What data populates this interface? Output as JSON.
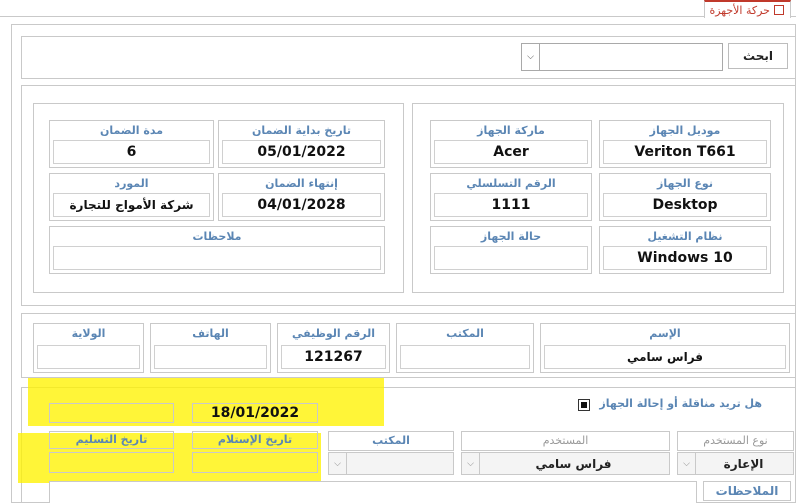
{
  "tab": {
    "title": "حركة الأجهزة"
  },
  "search": {
    "button_label": "ابحث",
    "value": ""
  },
  "device": {
    "model": {
      "label": "موديل الجهاز",
      "value": "Veriton T661"
    },
    "brand": {
      "label": "ماركة الجهاز",
      "value": "Acer"
    },
    "type": {
      "label": "نوع الجهاز",
      "value": "Desktop"
    },
    "serial": {
      "label": "الرقم التسلسلي",
      "value": "1111"
    },
    "os": {
      "label": "نظام التشغيل",
      "value": "Windows 10"
    },
    "status": {
      "label": "حالة الجهاز",
      "value": ""
    }
  },
  "warranty": {
    "start": {
      "label": "تاريخ بداية الضمان",
      "value": "05/01/2022"
    },
    "duration": {
      "label": "مدة الضمان",
      "value": "6"
    },
    "end": {
      "label": "إنتهاء الضمان",
      "value": "04/01/2028"
    },
    "supplier": {
      "label": "المورد",
      "value": "شركة الأمواج للتجارة"
    },
    "notes": {
      "label": "ملاحظات",
      "value": ""
    }
  },
  "employee": {
    "name": {
      "label": "الإسم",
      "value": "فراس سامي"
    },
    "office": {
      "label": "المكتب",
      "value": ""
    },
    "job_number": {
      "label": "الرقم الوظيفي",
      "value": "121267"
    },
    "phone": {
      "label": "الهاتف",
      "value": ""
    },
    "province": {
      "label": "الولاية",
      "value": ""
    }
  },
  "transfer": {
    "question": "هل تريد مناقلة أو إحالة الجهاز",
    "checked": true,
    "date_value": "18/01/2022",
    "user_type": {
      "label": "نوع المستخدم",
      "value": "الإعارة"
    },
    "user": {
      "label": "المستخدم",
      "value": "فراس سامي"
    },
    "office": {
      "label": "المكتب",
      "value": ""
    },
    "receive_date": {
      "label": "تاريخ الإستلام",
      "value": ""
    },
    "handover_date": {
      "label": "تاريخ التسليم",
      "value": ""
    },
    "notes_label": "الملاحظات"
  },
  "colors": {
    "label": "#5b86b4",
    "highlight": "#fff200",
    "tab_accent": "#c0392b"
  }
}
